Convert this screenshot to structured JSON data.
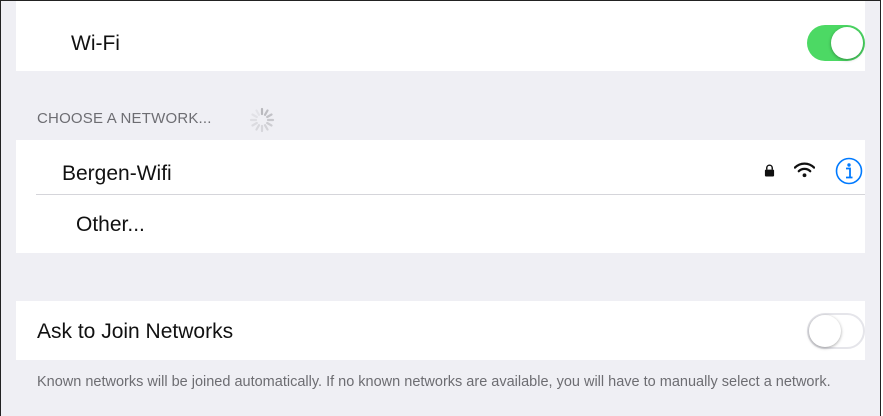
{
  "wifi": {
    "label": "Wi-Fi",
    "toggle_on": true,
    "toggle_color": "#4cd964"
  },
  "networks": {
    "header": "CHOOSE A NETWORK...",
    "spinner_icon": "activity-spinner-icon",
    "items": [
      {
        "name": "Bergen-Wifi",
        "icons": [
          "lock-icon",
          "wifi-signal-icon",
          "info-icon"
        ]
      },
      {
        "name": "Other..."
      }
    ],
    "info_color": "#007aff"
  },
  "ask_to_join": {
    "label": "Ask to Join Networks",
    "toggle_on": false,
    "footer": "Known networks will be joined automatically. If no known networks are available, you will have to manually select a network."
  }
}
